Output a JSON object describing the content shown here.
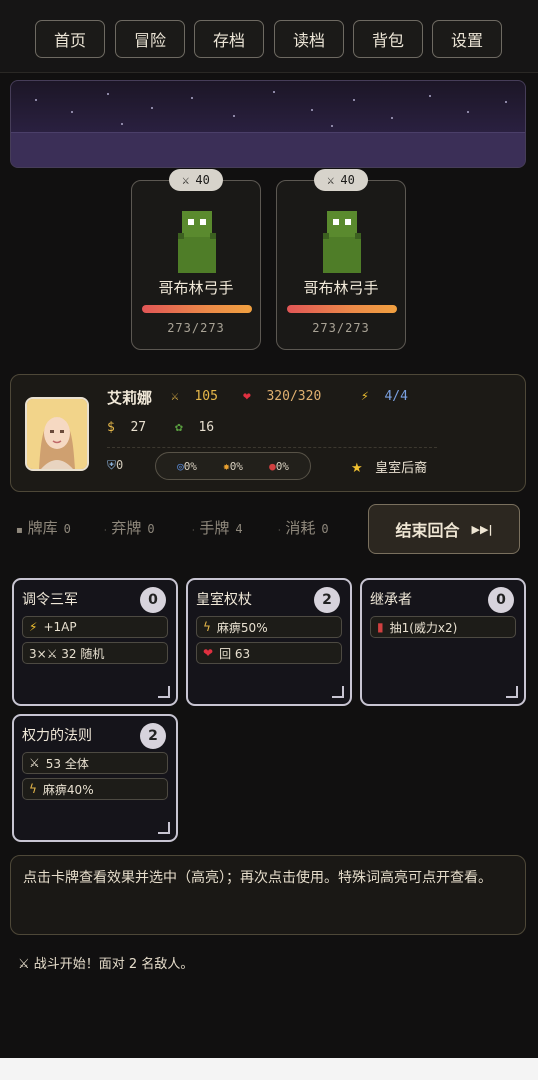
{
  "nav": [
    "首页",
    "冒险",
    "存档",
    "读档",
    "背包",
    "设置"
  ],
  "enemies": [
    {
      "attack": "40",
      "name": "哥布林弓手",
      "hp": "273/273"
    },
    {
      "attack": "40",
      "name": "哥布林弓手",
      "hp": "273/273"
    }
  ],
  "player": {
    "name": "艾莉娜",
    "attack": "105",
    "hp": "320/320",
    "energy": "4/4",
    "gold": "27",
    "herb": "16",
    "shield": "0",
    "res1": "0%",
    "res2": "0%",
    "res3": "0%",
    "title": "皇室后裔"
  },
  "deck": {
    "draw_label": "牌库",
    "draw_count": "0",
    "discard_label": "弃牌",
    "discard_count": "0",
    "hand_label": "手牌",
    "hand_count": "4",
    "exhaust_label": "消耗",
    "exhaust_count": "0"
  },
  "end_turn_label": "结束回合",
  "cards": [
    {
      "title": "调令三军",
      "cost": "0",
      "effects": [
        "+1AP",
        "3×⚔ 32 随机"
      ]
    },
    {
      "title": "皇室权杖",
      "cost": "2",
      "effects": [
        "麻痹50%",
        "回 63"
      ]
    },
    {
      "title": "继承者",
      "cost": "0",
      "effects": [
        "抽1(威力x2)"
      ]
    },
    {
      "title": "权力的法则",
      "cost": "2",
      "effects": [
        "53 全体",
        "麻痹40%"
      ]
    }
  ],
  "hint": "点击卡牌查看效果并选中（高亮）；再次点击使用。特殊词高亮可点开查看。",
  "log": "战斗开始！面对 2 名敌人。",
  "colors": {
    "background": "#111010",
    "accent": "#e6b84a",
    "hp": "#e15656",
    "energy": "#7aa0e0"
  }
}
